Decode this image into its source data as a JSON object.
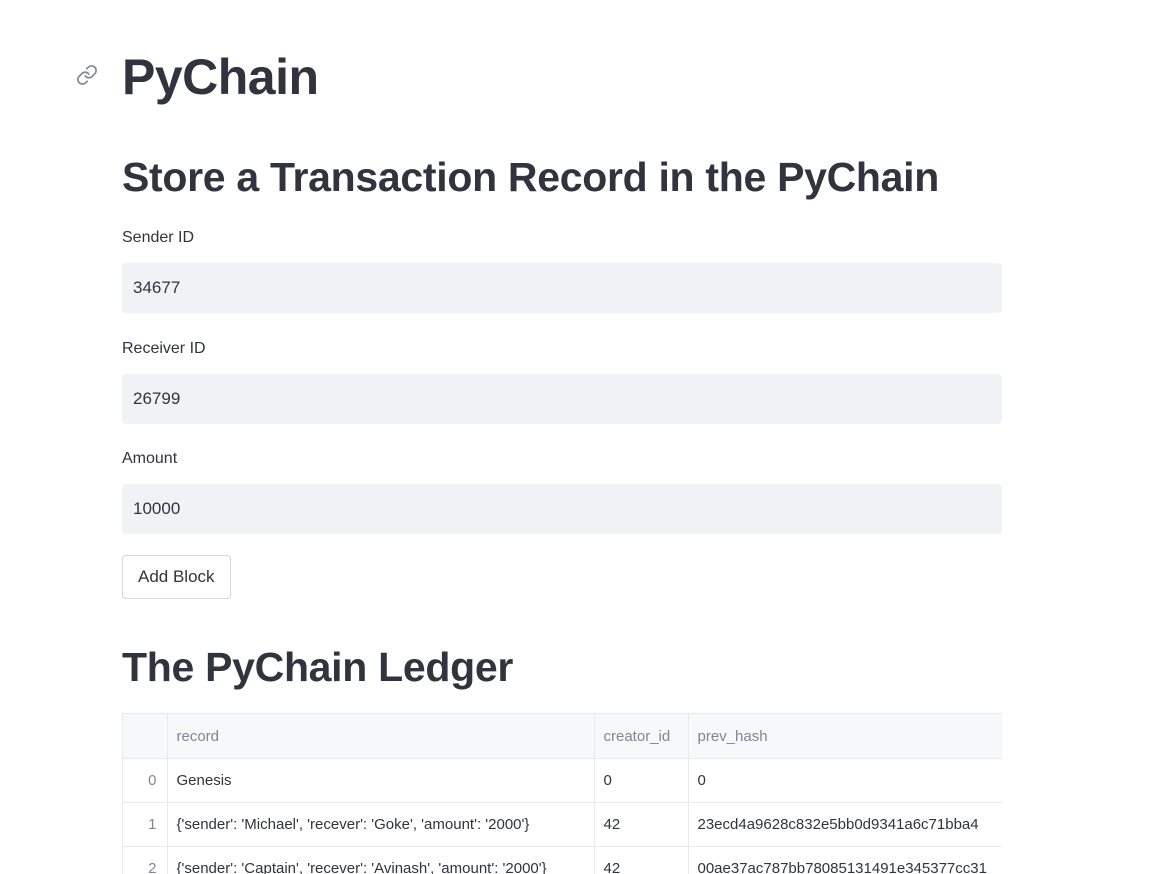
{
  "page": {
    "title": "PyChain",
    "anchor_icon": "link-icon"
  },
  "form": {
    "heading": "Store a Transaction Record in the PyChain",
    "sender_label": "Sender ID",
    "sender_value": "34677",
    "receiver_label": "Receiver ID",
    "receiver_value": "26799",
    "amount_label": "Amount",
    "amount_value": "10000",
    "submit_label": "Add Block"
  },
  "ledger": {
    "heading": "The PyChain Ledger",
    "columns": [
      "",
      "record",
      "creator_id",
      "prev_hash"
    ],
    "rows": [
      {
        "index": "0",
        "record": "Genesis",
        "creator_id": "0",
        "prev_hash": "0"
      },
      {
        "index": "1",
        "record": "{'sender': 'Michael', 'recever': 'Goke', 'amount': '2000'}",
        "creator_id": "42",
        "prev_hash": "23ecd4a9628c832e5bb0d9341a6c71bba4"
      },
      {
        "index": "2",
        "record": "{'sender': 'Captain', 'recever': 'Avinash', 'amount': '2000'}",
        "creator_id": "42",
        "prev_hash": "00ae37ac787bb78085131491e345377cc31"
      }
    ]
  },
  "colors": {
    "text": "#31333f",
    "input_bg": "#f0f2f6",
    "muted": "#808495",
    "border": "#e6e9ef"
  }
}
